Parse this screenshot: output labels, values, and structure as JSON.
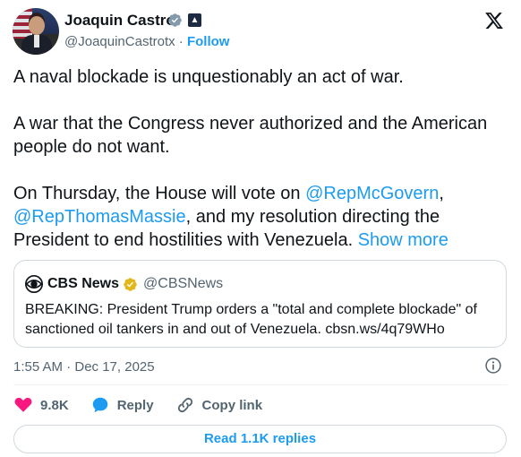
{
  "author": {
    "name": "Joaquin Castro",
    "handle": "@JoaquinCastrotx",
    "separator": "·",
    "follow_label": "Follow",
    "verified_color": "#829aab",
    "affiliation_icon": "government-badge-icon"
  },
  "tweet": {
    "para1": "A naval blockade is unquestionably an act of war.",
    "para2": "A war that the Congress never authorized and the American people do not want.",
    "para3_before": "On Thursday, the House will vote on ",
    "mention1": "@RepMcGovern",
    "para3_comma": ",",
    "mention2": "@RepThomasMassie",
    "para3_after": ", and my resolution directing the President to end hostilities with Venezuela.",
    "show_more": "Show more"
  },
  "quote": {
    "name": "CBS News",
    "handle": "@CBSNews",
    "text": "BREAKING: President Trump orders a \"total and complete blockade\" of sanctioned oil tankers in and out of Venezuela. cbsn.ws/4q79WHo",
    "verified_color": "#e2b719"
  },
  "meta": {
    "timestamp": "1:55 AM · Dec 17, 2025"
  },
  "actions": {
    "likes": "9.8K",
    "reply": "Reply",
    "copy_link": "Copy link",
    "like_color": "#f91880",
    "reply_color": "#1d9bf0"
  },
  "footer": {
    "read_replies": "Read 1.1K replies"
  },
  "colors": {
    "accent": "#1d9bf0",
    "text": "#0f1419",
    "muted": "#536471",
    "border": "#cfd9de"
  }
}
